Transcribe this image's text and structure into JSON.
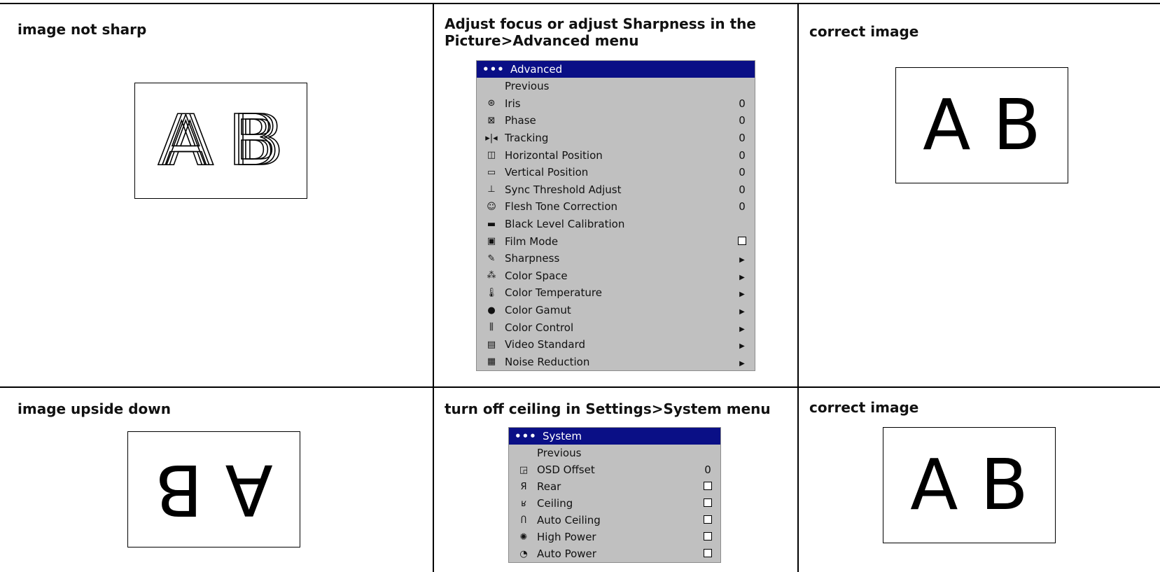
{
  "cells": {
    "r1c1": {
      "title": "image not sharp",
      "letters": "A B"
    },
    "r1c2": {
      "title_line1": "Adjust focus or adjust Sharpness in the",
      "title_line2": "Picture>Advanced menu"
    },
    "r1c3": {
      "title": "correct image",
      "letters": "A B"
    },
    "r2c1": {
      "title": "image upside down",
      "letters": "A B"
    },
    "r2c2": {
      "title": "turn off ceiling in Settings>System menu"
    },
    "r2c3": {
      "title": "correct image",
      "letters": "A B"
    }
  },
  "advanced_menu": {
    "dots": "•••",
    "title": "Advanced",
    "previous": "Previous",
    "items": [
      {
        "label": "Iris",
        "value": "0",
        "icon": "iris-icon"
      },
      {
        "label": "Phase",
        "value": "0",
        "icon": "phase-icon"
      },
      {
        "label": "Tracking",
        "value": "0",
        "icon": "tracking-icon"
      },
      {
        "label": "Horizontal Position",
        "value": "0",
        "icon": "horizontal-position-icon"
      },
      {
        "label": "Vertical Position",
        "value": "0",
        "icon": "vertical-position-icon"
      },
      {
        "label": "Sync Threshold Adjust",
        "value": "0",
        "icon": "sync-threshold-icon"
      },
      {
        "label": "Flesh Tone Correction",
        "value": "0",
        "icon": "flesh-tone-icon"
      },
      {
        "label": "Black Level Calibration",
        "value": "",
        "icon": "black-level-icon"
      },
      {
        "label": "Film Mode",
        "value": "checkbox",
        "icon": "film-mode-icon"
      },
      {
        "label": "Sharpness",
        "value": "arrow",
        "icon": "sharpness-icon"
      },
      {
        "label": "Color Space",
        "value": "arrow",
        "icon": "color-space-icon"
      },
      {
        "label": "Color Temperature",
        "value": "arrow",
        "icon": "color-temperature-icon"
      },
      {
        "label": "Color Gamut",
        "value": "arrow",
        "icon": "color-gamut-icon"
      },
      {
        "label": "Color Control",
        "value": "arrow",
        "icon": "color-control-icon"
      },
      {
        "label": "Video Standard",
        "value": "arrow",
        "icon": "video-standard-icon"
      },
      {
        "label": "Noise Reduction",
        "value": "arrow",
        "icon": "noise-reduction-icon"
      }
    ]
  },
  "system_menu": {
    "dots": "•••",
    "title": "System",
    "previous": "Previous",
    "items": [
      {
        "label": "OSD Offset",
        "value": "0",
        "icon": "osd-offset-icon"
      },
      {
        "label": "Rear",
        "value": "checkbox",
        "icon": "rear-icon"
      },
      {
        "label": "Ceiling",
        "value": "checkbox",
        "icon": "ceiling-icon"
      },
      {
        "label": "Auto Ceiling",
        "value": "checkbox",
        "icon": "auto-ceiling-icon"
      },
      {
        "label": "High Power",
        "value": "checkbox",
        "icon": "high-power-icon"
      },
      {
        "label": "Auto Power",
        "value": "checkbox",
        "icon": "auto-power-icon"
      }
    ]
  },
  "colors": {
    "osd_header": "#0a0f86",
    "osd_body": "#c0c0c0",
    "grid": "#000000"
  }
}
